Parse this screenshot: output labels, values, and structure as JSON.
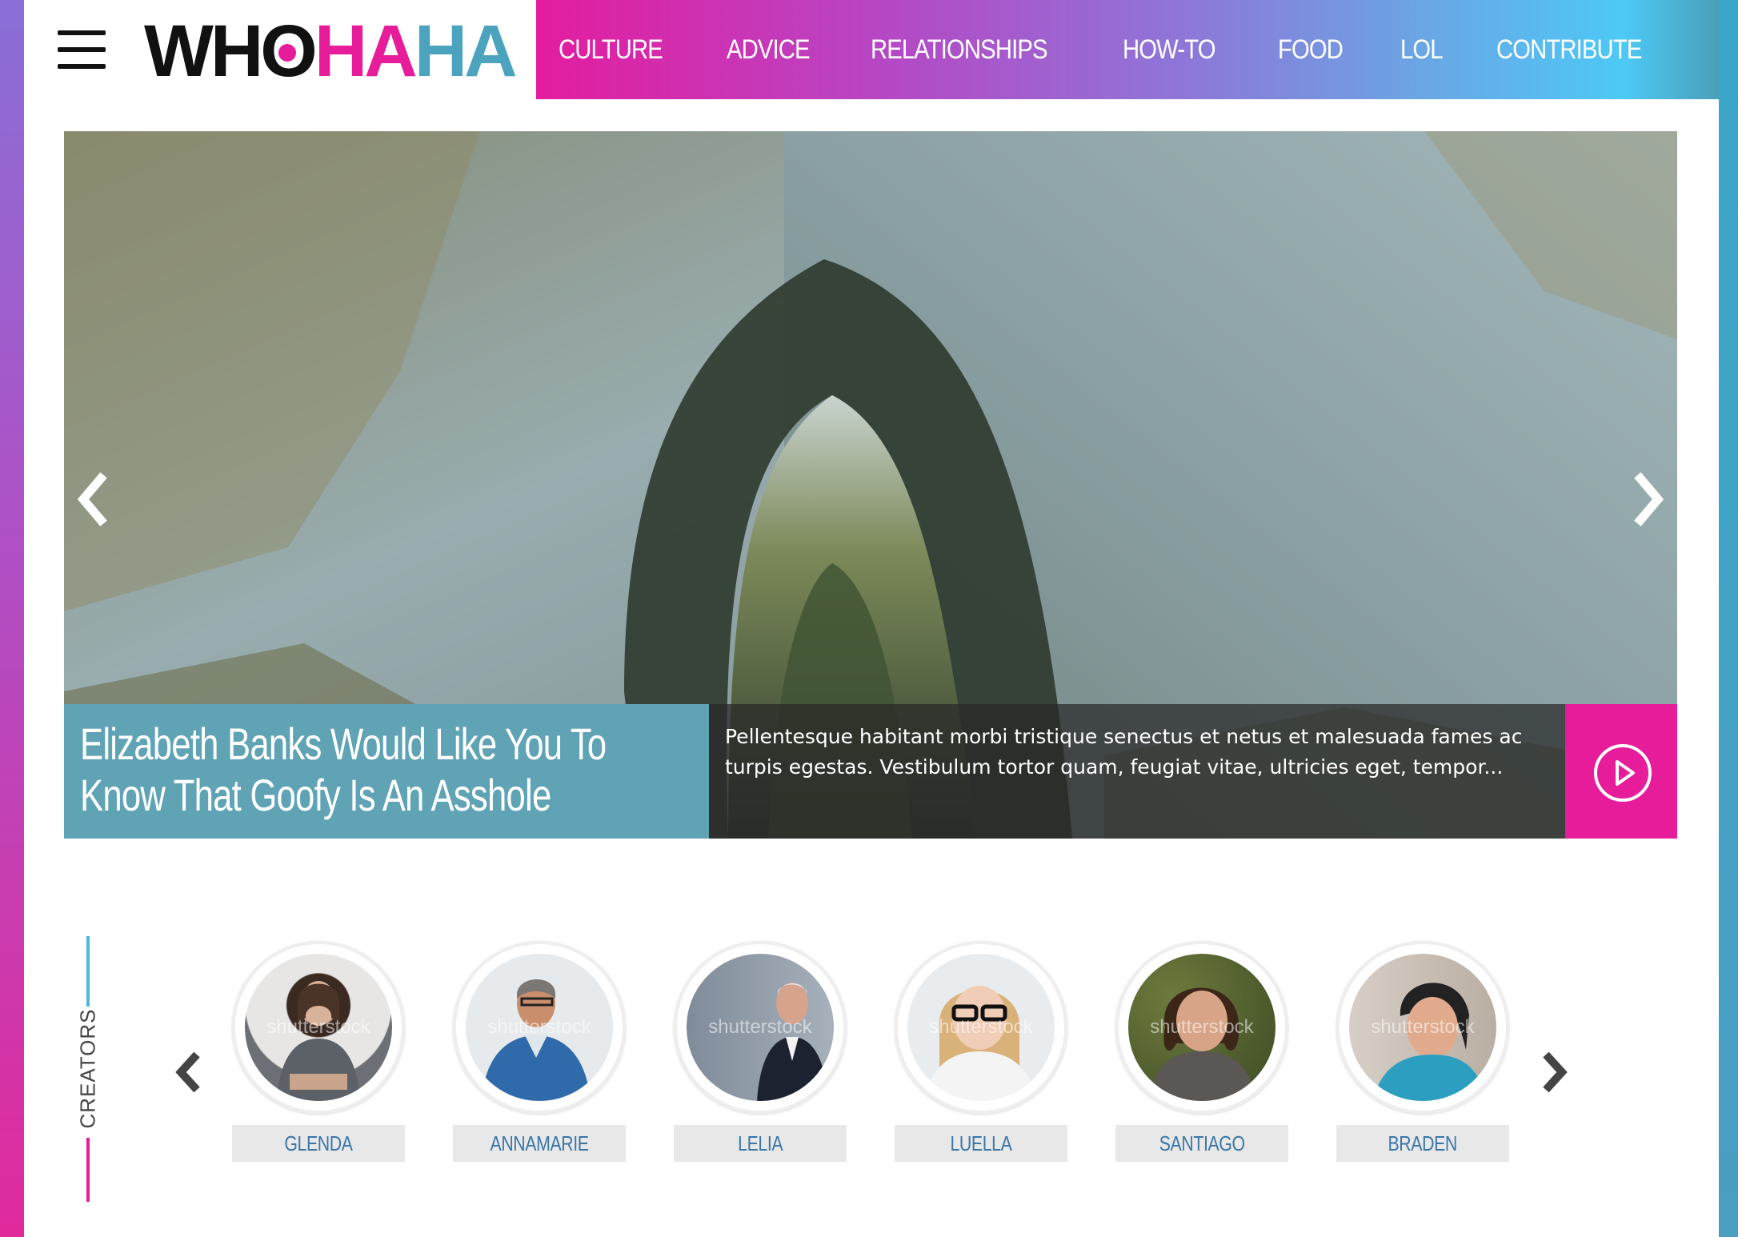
{
  "logo": {
    "part_who_w": "WH",
    "part_who_o": "O",
    "part_ha1": "HA",
    "part_ha2": "HA"
  },
  "nav": {
    "items": [
      {
        "label": "CULTURE"
      },
      {
        "label": "ADVICE"
      },
      {
        "label": "RELATIONSHIPS"
      },
      {
        "label": "HOW-TO"
      },
      {
        "label": "FOOD"
      },
      {
        "label": "LOL"
      },
      {
        "label": "CONTRIBUTE"
      }
    ]
  },
  "hero": {
    "title": "Elizabeth Banks Would Like You To Know That Goofy Is An Asshole",
    "excerpt": "Pellentesque habitant morbi tristique senectus et netus et malesuada fames ac turpis egestas. Vestibulum tortor quam, feugiat vitae, ultricies eget, tempor..."
  },
  "creators": {
    "label": "CREATORS",
    "watermark": "shutterstock",
    "people": [
      {
        "name": "GLENDA"
      },
      {
        "name": "ANNAMARIE"
      },
      {
        "name": "LELIA"
      },
      {
        "name": "LUELLA"
      },
      {
        "name": "SANTIAGO"
      },
      {
        "name": "BRADEN"
      }
    ]
  },
  "colors": {
    "brand_pink": "#e61c9a",
    "brand_teal": "#5fa3b5",
    "name_text": "#3a76a8"
  }
}
